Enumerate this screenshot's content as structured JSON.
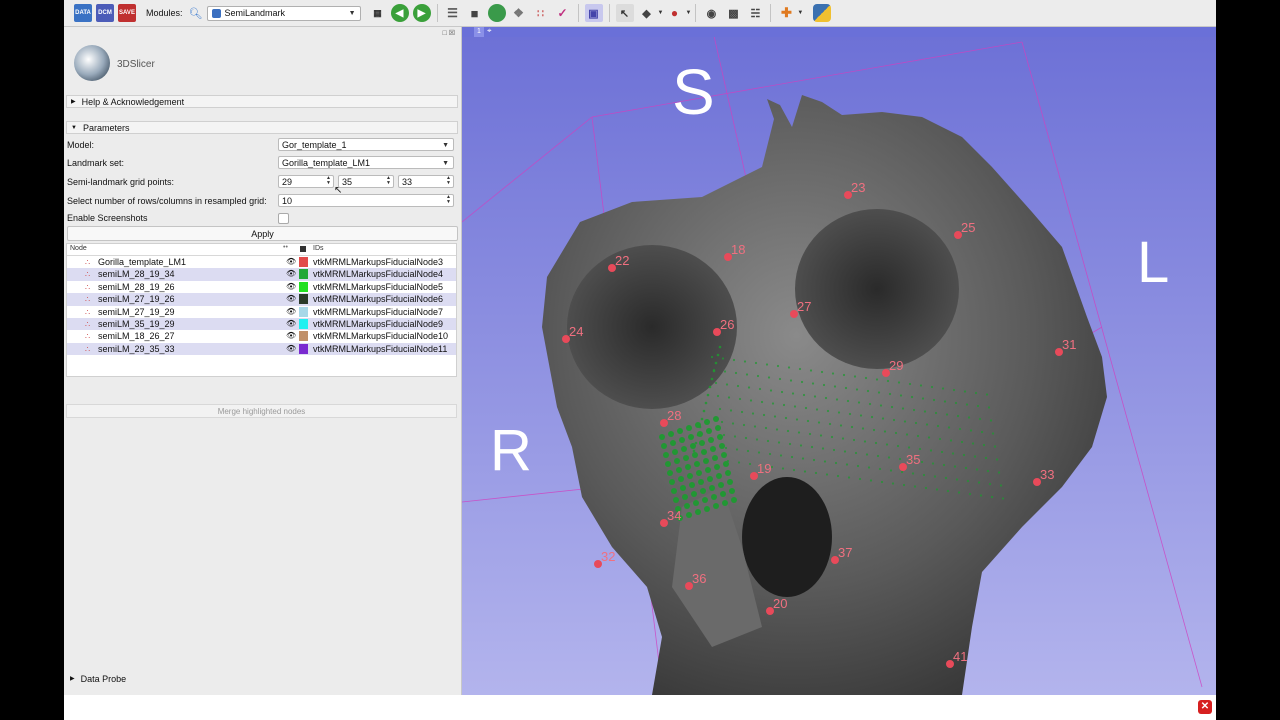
{
  "toolbar": {
    "modules_label": "Modules:",
    "module_selected": "SemiLandmark",
    "load_buttons": [
      "DATA",
      "DCM",
      "SAVE"
    ]
  },
  "logo_text": "3DSlicer",
  "sections": {
    "help": "Help & Acknowledgement",
    "parameters": "Parameters",
    "data_probe": "Data Probe"
  },
  "params": {
    "model_label": "Model:",
    "model_value": "Gor_template_1",
    "landmark_label": "Landmark set:",
    "landmark_value": "Gorilla_template_LM1",
    "grid_label": "Semi-landmark grid points:",
    "grid_x": "29",
    "grid_y": "35",
    "grid_z": "33",
    "rows_label": "Select number of rows/columns in resampled grid:",
    "rows_value": "10",
    "screenshots_label": "Enable Screenshots",
    "apply_label": "Apply"
  },
  "tree": {
    "col_node": "Node",
    "col_ids": "IDs",
    "rows": [
      {
        "name": "Gorilla_template_LM1",
        "id": "vtkMRMLMarkupsFiducialNode3",
        "color": "#e24a4a",
        "selected": false
      },
      {
        "name": "semiLM_28_19_34",
        "id": "vtkMRMLMarkupsFiducialNode4",
        "color": "#21a838",
        "selected": true
      },
      {
        "name": "semiLM_28_19_26",
        "id": "vtkMRMLMarkupsFiducialNode5",
        "color": "#22e022",
        "selected": false
      },
      {
        "name": "semiLM_27_19_26",
        "id": "vtkMRMLMarkupsFiducialNode6",
        "color": "#2a3a2a",
        "selected": true
      },
      {
        "name": "semiLM_27_19_29",
        "id": "vtkMRMLMarkupsFiducialNode7",
        "color": "#a8d8e8",
        "selected": false
      },
      {
        "name": "semiLM_35_19_29",
        "id": "vtkMRMLMarkupsFiducialNode9",
        "color": "#20f0f0",
        "selected": true
      },
      {
        "name": "semiLM_18_26_27",
        "id": "vtkMRMLMarkupsFiducialNode10",
        "color": "#c0906a",
        "selected": false
      },
      {
        "name": "semiLM_29_35_33",
        "id": "vtkMRMLMarkupsFiducialNode11",
        "color": "#7a2ad0",
        "selected": true
      }
    ]
  },
  "merge_label": "Merge highlighted nodes",
  "view": {
    "layout_number": "1",
    "orient_s": "S",
    "orient_r": "R",
    "orient_l": "L",
    "landmarks": [
      "23",
      "25",
      "18",
      "22",
      "27",
      "26",
      "24",
      "29",
      "31",
      "28",
      "35",
      "19",
      "33",
      "34",
      "37",
      "32",
      "36",
      "20",
      "41"
    ]
  },
  "colors": {
    "view_bg_top": "#6c70d6",
    "view_bg_bottom": "#b3b4ed",
    "landmark": "#e84a5a",
    "semi_landmark": "#1e9a30"
  }
}
